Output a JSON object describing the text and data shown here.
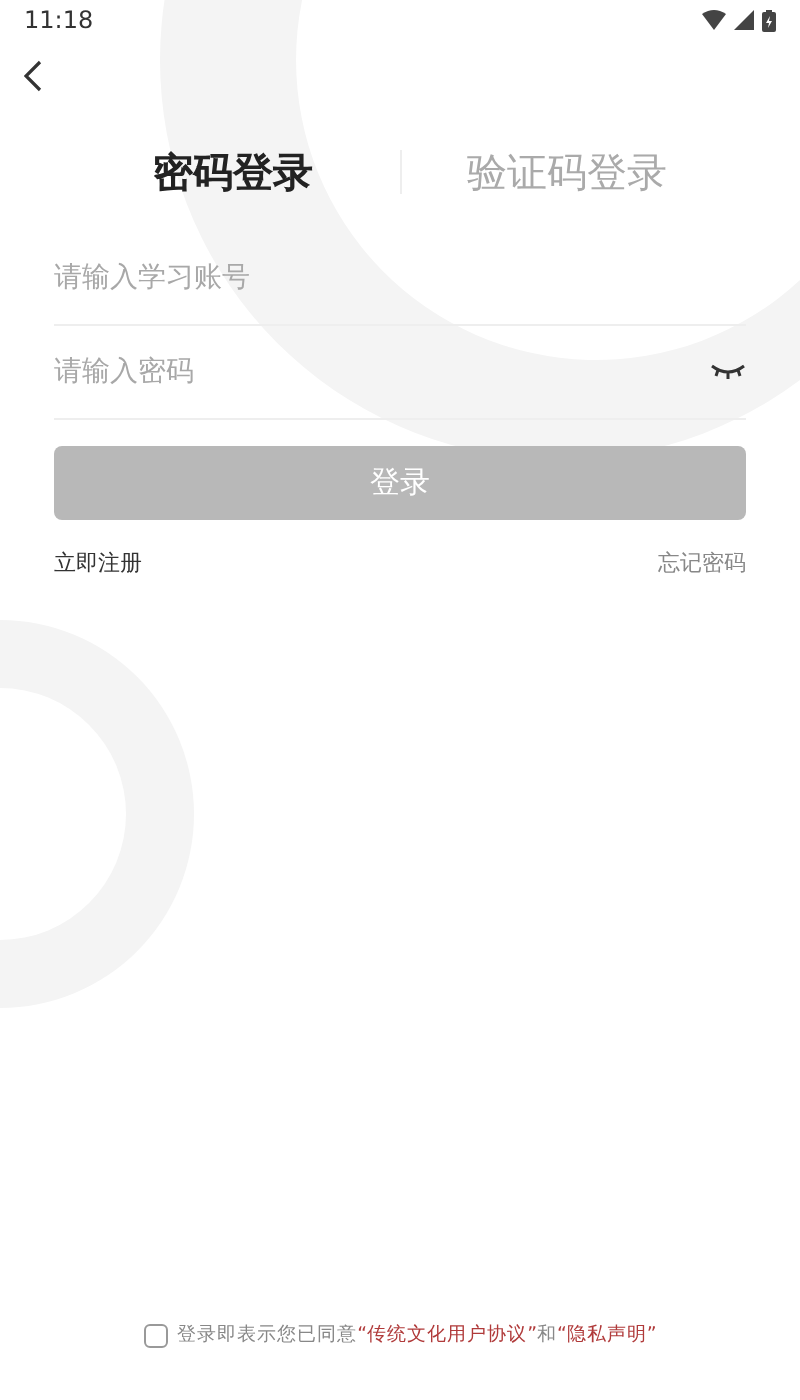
{
  "status_bar": {
    "time": "11:18"
  },
  "tabs": [
    {
      "label": "密码登录",
      "selected": true
    },
    {
      "label": "验证码登录",
      "selected": false
    }
  ],
  "fields": [
    {
      "placeholder": "请输入学习账号",
      "kind": "text"
    },
    {
      "placeholder": "请输入密码",
      "kind": "password"
    }
  ],
  "login_button": {
    "label": "登录",
    "disabled": true
  },
  "links": {
    "register": "立即注册",
    "forgot": "忘记密码"
  },
  "agreement": {
    "checked": false,
    "parts": [
      {
        "text": "登录即表示您已同意",
        "kind": "plain"
      },
      {
        "text": "“传统文化用户协议”",
        "kind": "link"
      },
      {
        "text": "和",
        "kind": "plain"
      },
      {
        "text": "“隐私声明”",
        "kind": "link"
      }
    ]
  }
}
